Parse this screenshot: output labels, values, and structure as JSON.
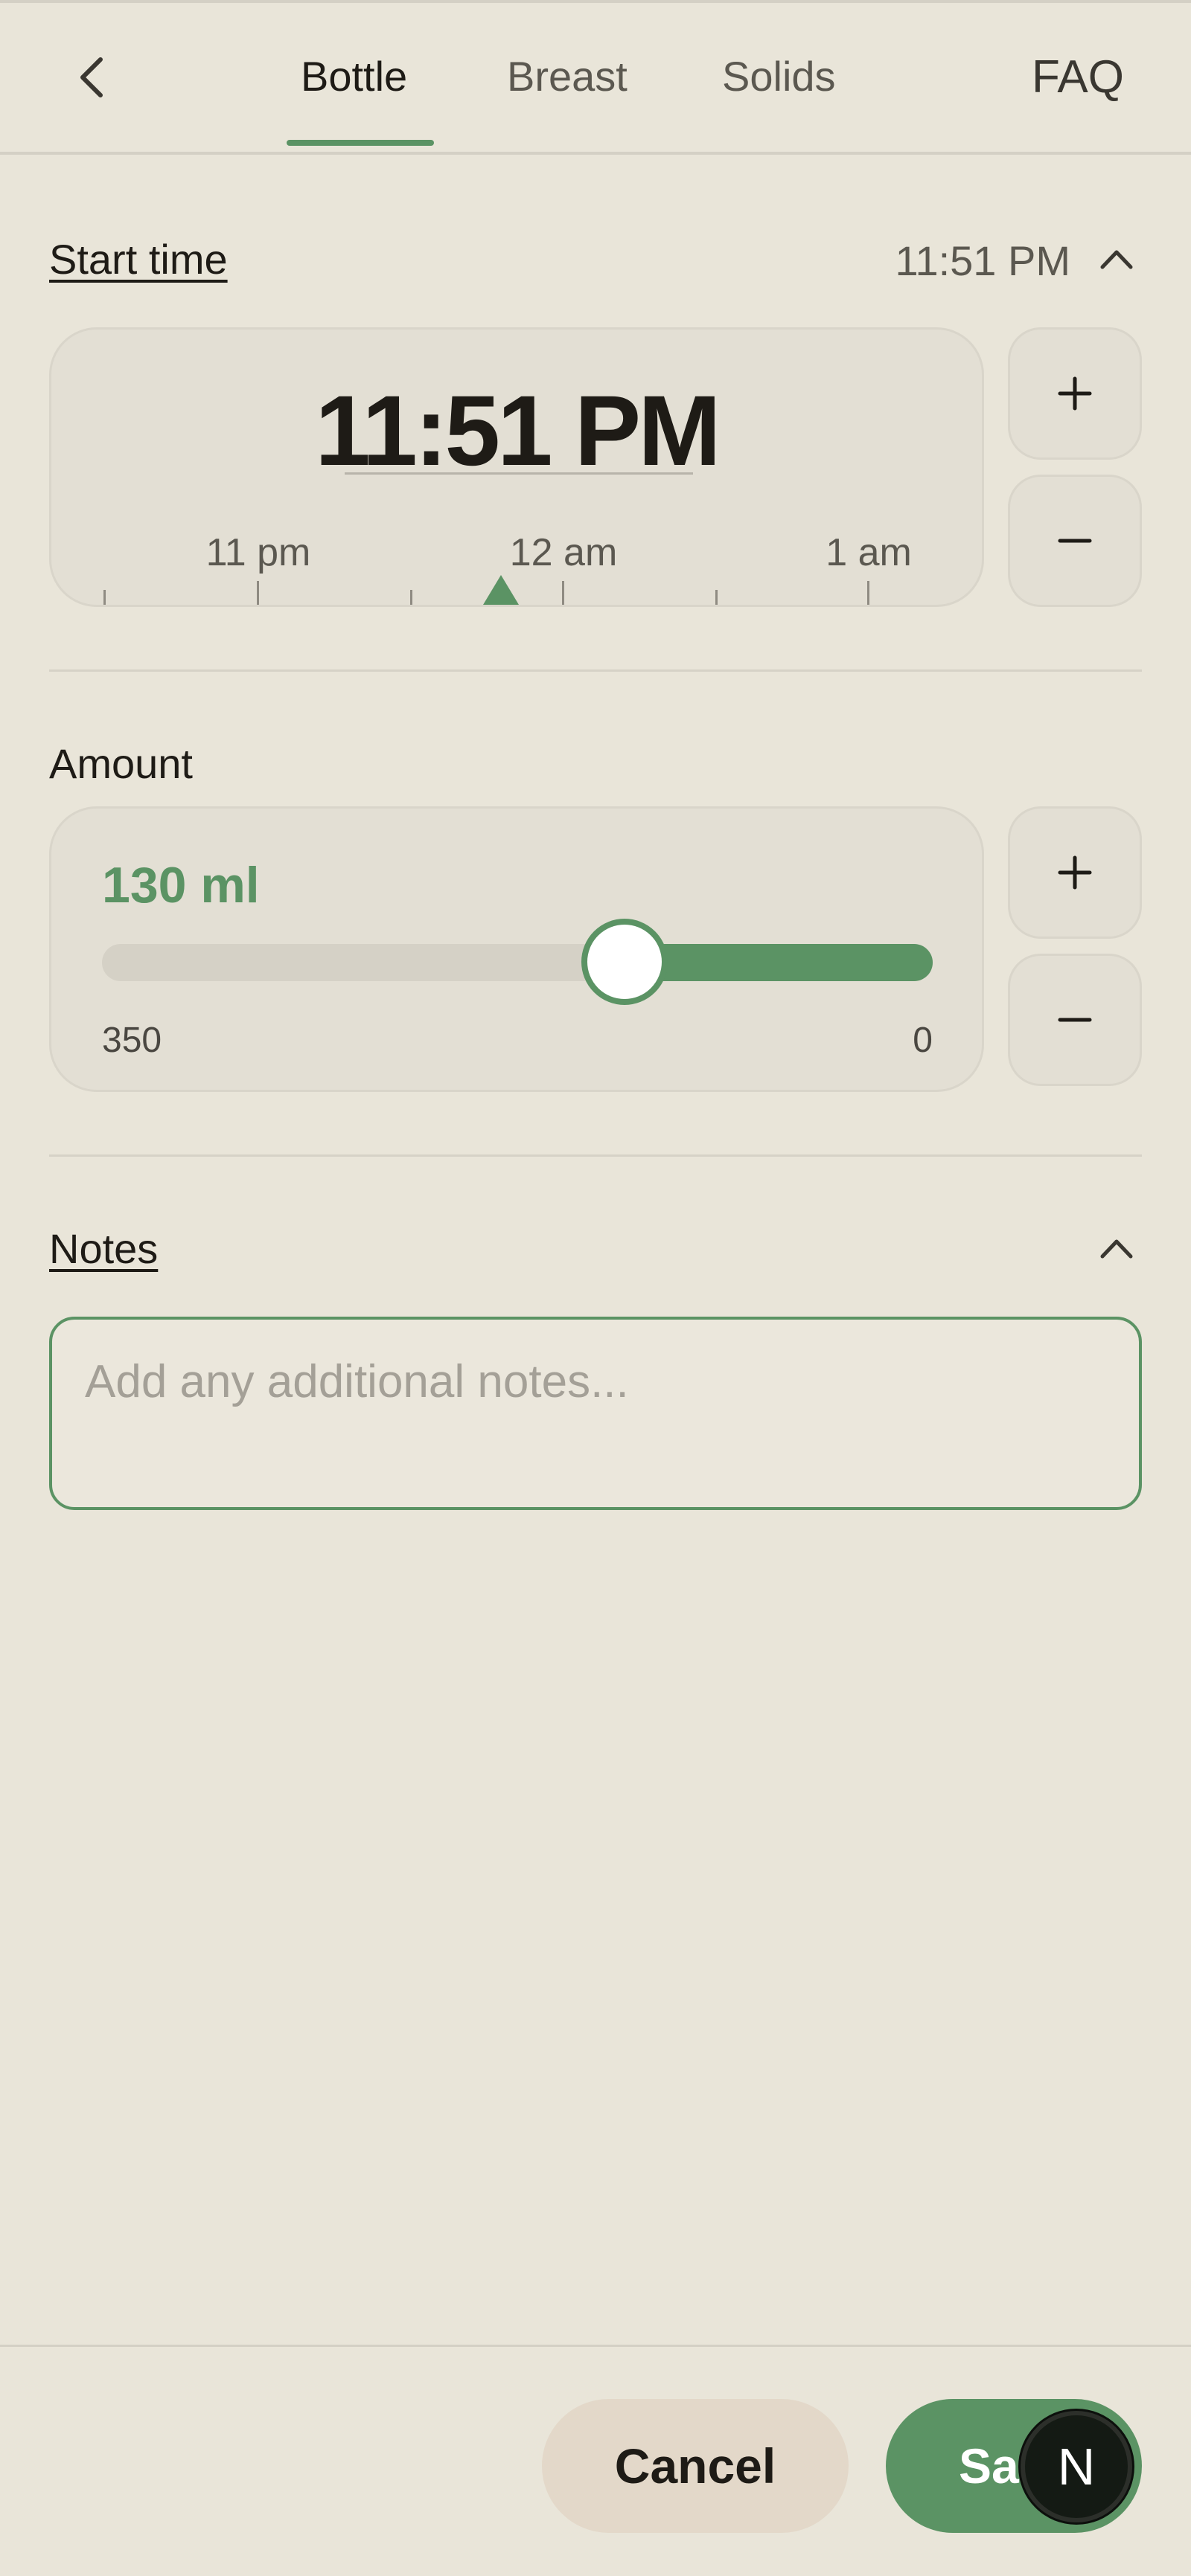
{
  "header": {
    "tabs": [
      {
        "label": "Bottle",
        "active": true
      },
      {
        "label": "Breast",
        "active": false
      },
      {
        "label": "Solids",
        "active": false
      }
    ],
    "faq_label": "FAQ"
  },
  "start_time": {
    "title": "Start time",
    "summary": "11:51 PM",
    "big_time": "11:51 PM",
    "tick_labels": [
      "11 pm",
      "12 am",
      "1 am"
    ]
  },
  "amount": {
    "title": "Amount",
    "value": "130 ml",
    "range_left": "350",
    "range_right": "0",
    "slider_fraction_from_left": 0.6286
  },
  "notes": {
    "title": "Notes",
    "placeholder": "Add any additional notes..."
  },
  "footer": {
    "cancel_label": "Cancel",
    "save_label": "Sa",
    "avatar_letter": "N"
  },
  "colors": {
    "accent": "#5b9364",
    "background": "#e9e5d9",
    "card": "#e3dfd4",
    "cancel_bg": "#e3d8c9"
  },
  "icons": {
    "back": "chevron-left-icon",
    "collapse": "chevron-up-icon",
    "plus": "plus-icon",
    "minus": "minus-icon"
  }
}
